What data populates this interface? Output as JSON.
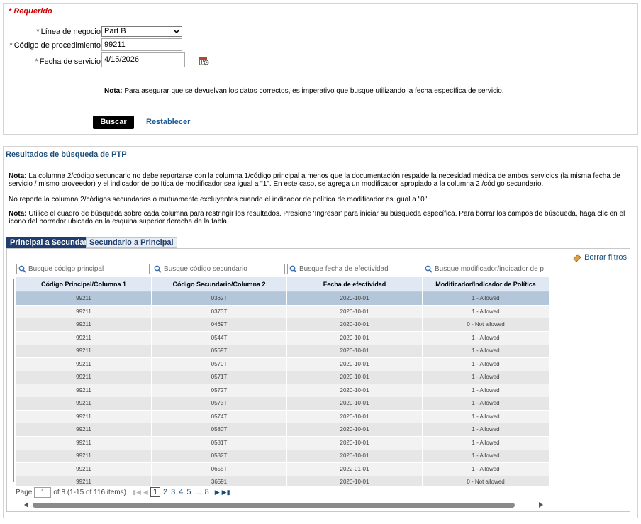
{
  "form": {
    "required_label": "* Requerido",
    "line_of_business": {
      "label": "Línea de negocio",
      "value": "Part B"
    },
    "procedure_code": {
      "label": "Código de procedimiento",
      "value": "99211"
    },
    "service_date": {
      "label": "Fecha de servicio",
      "value": "4/15/2026"
    },
    "note_prefix": "Nota:",
    "note_text": "Para asegurar que se devuelvan los datos correctos, es imperativo que busque utilizando la fecha específica de servicio.",
    "search_button": "Buscar",
    "reset_link": "Restablecer"
  },
  "results": {
    "title": "Resultados de búsqueda de PTP",
    "note1_prefix": "Nota:",
    "note1_text": "La columna 2/código secundario no debe reportarse con la columna 1/código principal a menos que la documentación respalde la necesidad médica de ambos servicios (la misma fecha de servicio / mismo proveedor) y el indicador de política de modificador sea igual a \"1\". En este caso, se agrega un modificador apropiado a la columna 2 /código secundario.",
    "note2_text": "No reporte la columna 2/códigos secundarios o mutuamente excluyentes cuando el indicador de política de modificador es igual a \"0\".",
    "note3_prefix": "Nota:",
    "note3_text": "Utilice el cuadro de búsqueda sobre cada columna para restringir los resultados. Presione 'Ingresar' para iniciar su búsqueda específica. Para borrar los campos de búsqueda, haga clic en el ícono del borrador ubicado en la esquina superior derecha de la tabla.",
    "tabs": [
      {
        "label": "Principal a Secundario",
        "active": true
      },
      {
        "label": "Secundario a Principal",
        "active": false
      }
    ],
    "clear_filters": "Borrar filtros",
    "filters": [
      "Busque código principal",
      "Busque código secundario",
      "Busque fecha de efectividad",
      "Busque modificador/indicador de p"
    ],
    "columns": [
      "Código Principal/Columna 1",
      "Código Secundario/Columna 2",
      "Fecha de efectividad",
      "Modificador/Indicador de Política"
    ],
    "rows": [
      [
        "99211",
        "0362T",
        "2020-10-01",
        "1 - Allowed"
      ],
      [
        "99211",
        "0373T",
        "2020-10-01",
        "1 - Allowed"
      ],
      [
        "99211",
        "0469T",
        "2020-10-01",
        "0 - Not allowed"
      ],
      [
        "99211",
        "0544T",
        "2020-10-01",
        "1 - Allowed"
      ],
      [
        "99211",
        "0569T",
        "2020-10-01",
        "1 - Allowed"
      ],
      [
        "99211",
        "0570T",
        "2020-10-01",
        "1 - Allowed"
      ],
      [
        "99211",
        "0571T",
        "2020-10-01",
        "1 - Allowed"
      ],
      [
        "99211",
        "0572T",
        "2020-10-01",
        "1 - Allowed"
      ],
      [
        "99211",
        "0573T",
        "2020-10-01",
        "1 - Allowed"
      ],
      [
        "99211",
        "0574T",
        "2020-10-01",
        "1 - Allowed"
      ],
      [
        "99211",
        "0580T",
        "2020-10-01",
        "1 - Allowed"
      ],
      [
        "99211",
        "0581T",
        "2020-10-01",
        "1 - Allowed"
      ],
      [
        "99211",
        "0582T",
        "2020-10-01",
        "1 - Allowed"
      ],
      [
        "99211",
        "0655T",
        "2022-01-01",
        "1 - Allowed"
      ],
      [
        "99211",
        "36591",
        "2020-10-01",
        "0 - Not allowed"
      ]
    ],
    "pager": {
      "page_label": "Page",
      "current_page": "1",
      "of_text": "of 8 (1-15 of 116 items)",
      "pages": [
        "1",
        "2",
        "3",
        "4",
        "5",
        "...",
        "8"
      ]
    }
  }
}
